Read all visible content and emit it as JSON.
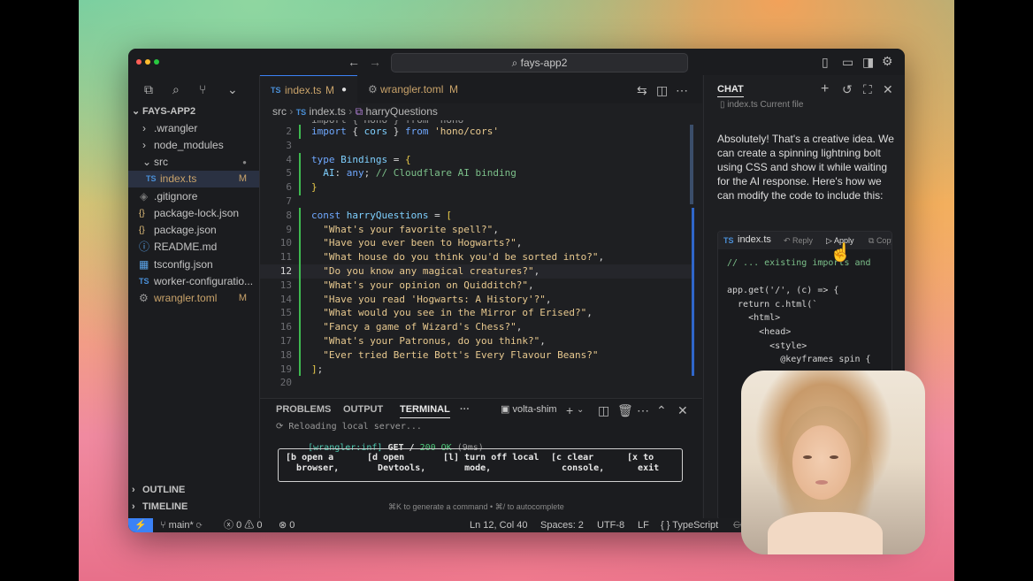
{
  "titlebar": {
    "search": "fays-app2"
  },
  "tabs": [
    {
      "badge": "TS",
      "label": "index.ts",
      "status": "M"
    },
    {
      "badge": "⚙",
      "label": "wrangler.toml",
      "status": "M"
    }
  ],
  "breadcrumb": {
    "folder": "src",
    "badge": "TS",
    "file": "index.ts",
    "symbol": "harryQuestions"
  },
  "explorer": {
    "root": "FAYS-APP2",
    "items": [
      {
        "label": ".wrangler",
        "icon": "›",
        "status": ""
      },
      {
        "label": "node_modules",
        "icon": "›",
        "status": ""
      },
      {
        "label": "src",
        "icon": "⌄",
        "status": "●"
      },
      {
        "label": "index.ts",
        "icon": "TS",
        "status": "M"
      },
      {
        "label": ".gitignore",
        "icon": "◈",
        "status": ""
      },
      {
        "label": "package-lock.json",
        "icon": "{}",
        "status": ""
      },
      {
        "label": "package.json",
        "icon": "{}",
        "status": ""
      },
      {
        "label": "README.md",
        "icon": "ⓘ",
        "status": ""
      },
      {
        "label": "tsconfig.json",
        "icon": "▦",
        "status": ""
      },
      {
        "label": "worker-configuratio...",
        "icon": "TS",
        "status": ""
      },
      {
        "label": "wrangler.toml",
        "icon": "⚙",
        "status": "M"
      }
    ],
    "outline": "OUTLINE",
    "timeline": "TIMELINE"
  },
  "code": {
    "partial_first_line": "import { Hono } from 'hono'",
    "lines": [
      {
        "n": "2",
        "parts": [
          [
            "kw",
            "import "
          ],
          [
            "pl",
            "{ "
          ],
          [
            "id",
            "cors"
          ],
          [
            "pl",
            " } "
          ],
          [
            "kw",
            "from "
          ],
          [
            "str",
            "'hono/cors'"
          ]
        ]
      },
      {
        "n": "3",
        "parts": []
      },
      {
        "n": "4",
        "parts": [
          [
            "kw",
            "type "
          ],
          [
            "id",
            "Bindings"
          ],
          [
            "pl",
            " = "
          ],
          [
            "br",
            "{"
          ]
        ]
      },
      {
        "n": "5",
        "parts": [
          [
            "pl",
            "  "
          ],
          [
            "id",
            "AI"
          ],
          [
            "pl",
            ": "
          ],
          [
            "kw",
            "any"
          ],
          [
            "pl",
            "; "
          ],
          [
            "cmt",
            "// Cloudflare AI binding"
          ]
        ]
      },
      {
        "n": "6",
        "parts": [
          [
            "br",
            "}"
          ]
        ]
      },
      {
        "n": "7",
        "parts": []
      },
      {
        "n": "8",
        "parts": [
          [
            "kw",
            "const "
          ],
          [
            "id",
            "harryQuestions"
          ],
          [
            "pl",
            " = "
          ],
          [
            "br",
            "["
          ]
        ]
      },
      {
        "n": "9",
        "parts": [
          [
            "pl",
            "  "
          ],
          [
            "str",
            "\"What's your favorite spell?\""
          ],
          [
            "pl",
            ","
          ]
        ]
      },
      {
        "n": "10",
        "parts": [
          [
            "pl",
            "  "
          ],
          [
            "str",
            "\"Have you ever been to Hogwarts?\""
          ],
          [
            "pl",
            ","
          ]
        ]
      },
      {
        "n": "11",
        "parts": [
          [
            "pl",
            "  "
          ],
          [
            "str",
            "\"What house do you think you'd be sorted into?\""
          ],
          [
            "pl",
            ","
          ]
        ]
      },
      {
        "n": "12",
        "parts": [
          [
            "pl",
            "  "
          ],
          [
            "str",
            "\"Do you know any magical creatures?\""
          ],
          [
            "pl",
            ","
          ]
        ]
      },
      {
        "n": "13",
        "parts": [
          [
            "pl",
            "  "
          ],
          [
            "str",
            "\"What's your opinion on Quidditch?\""
          ],
          [
            "pl",
            ","
          ]
        ]
      },
      {
        "n": "14",
        "parts": [
          [
            "pl",
            "  "
          ],
          [
            "str",
            "\"Have you read 'Hogwarts: A History'?\""
          ],
          [
            "pl",
            ","
          ]
        ]
      },
      {
        "n": "15",
        "parts": [
          [
            "pl",
            "  "
          ],
          [
            "str",
            "\"What would you see in the Mirror of Erised?\""
          ],
          [
            "pl",
            ","
          ]
        ]
      },
      {
        "n": "16",
        "parts": [
          [
            "pl",
            "  "
          ],
          [
            "str",
            "\"Fancy a game of Wizard's Chess?\""
          ],
          [
            "pl",
            ","
          ]
        ]
      },
      {
        "n": "17",
        "parts": [
          [
            "pl",
            "  "
          ],
          [
            "str",
            "\"What's your Patronus, do you think?\""
          ],
          [
            "pl",
            ","
          ]
        ]
      },
      {
        "n": "18",
        "parts": [
          [
            "pl",
            "  "
          ],
          [
            "str",
            "\"Ever tried Bertie Bott's Every Flavour Beans?\""
          ]
        ]
      },
      {
        "n": "19",
        "parts": [
          [
            "br",
            "]"
          ],
          [
            "pl",
            ";"
          ]
        ]
      },
      {
        "n": "20",
        "parts": []
      }
    ],
    "current_line": "12"
  },
  "panel": {
    "tabs": [
      "PROBLEMS",
      "OUTPUT",
      "TERMINAL"
    ],
    "active_tab": "TERMINAL",
    "more": "···",
    "shell": "volta-shim",
    "term_line1": "⟳ Reloading local server...",
    "term_line2_prefix": "[wrangler:inf]",
    "term_line2_method": " GET / ",
    "term_line2_status": "200 OK",
    "term_line2_time": " (9ms)",
    "shortcuts": [
      {
        "key": "[b",
        "line1": "open a",
        "line2": "browser,"
      },
      {
        "key": "[d",
        "line1": "open",
        "line2": "Devtools,"
      },
      {
        "key": "[l]",
        "line1": "turn off local",
        "line2": "mode,"
      },
      {
        "key": "[c",
        "line1": "clear",
        "line2": "console,"
      },
      {
        "key": "[x",
        "line1": "to",
        "line2": "exit"
      }
    ],
    "hint": "⌘K to generate a command • ⌘/ to autocomplete"
  },
  "chat": {
    "title": "CHAT",
    "context_file": "index.ts",
    "context_label": "Current file",
    "message": "Absolutely! That's a creative idea. We can create a spinning lightning bolt using CSS and show it while waiting for the AI response. Here's how we can modify the code to include this:",
    "block_badge": "TS",
    "block_file": "index.ts",
    "reply": "Reply",
    "apply": "Apply",
    "copy": "Copy",
    "block_lines": [
      "// ... existing imports and",
      "",
      "app.get('/', (c) => {",
      "  return c.html(`",
      "    <html>",
      "      <head>",
      "        <style>",
      "          @keyframes spin {"
    ]
  },
  "status": {
    "branch": "main*",
    "errors": "0",
    "warnings": "0",
    "ports": "0",
    "position": "Ln 12, Col 40",
    "spaces": "Spaces: 2",
    "encoding": "UTF-8",
    "eol": "LF",
    "language": "TypeScript",
    "extra": "Cu"
  },
  "colors": {
    "accent_blue": "#3b82f6",
    "modified": "#c9a36a",
    "status_ok": "#3fb950"
  }
}
